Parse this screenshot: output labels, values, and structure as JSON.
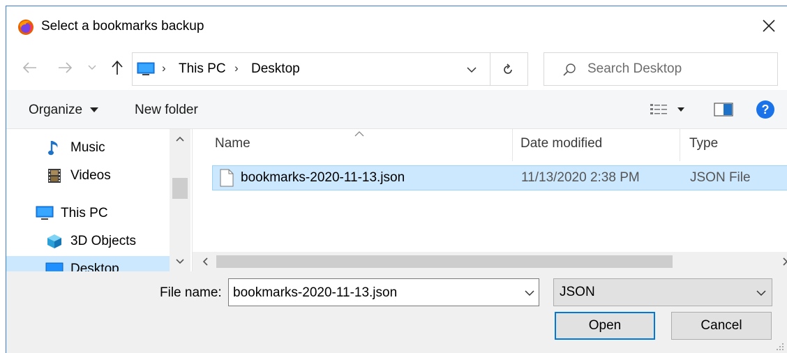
{
  "window": {
    "title": "Select a bookmarks backup"
  },
  "address": {
    "crumbs": [
      "This PC",
      "Desktop"
    ]
  },
  "search": {
    "placeholder": "Search Desktop"
  },
  "toolbar": {
    "organize_label": "Organize",
    "new_folder_label": "New folder"
  },
  "nav_pane": {
    "items": [
      {
        "label": "Music",
        "icon": "music-note-icon"
      },
      {
        "label": "Videos",
        "icon": "film-icon"
      },
      {
        "label": "This PC",
        "icon": "computer-icon"
      },
      {
        "label": "3D Objects",
        "icon": "cube-icon"
      },
      {
        "label": "Desktop",
        "icon": "desktop-icon",
        "selected": true
      }
    ]
  },
  "file_list": {
    "columns": [
      "Name",
      "Date modified",
      "Type"
    ],
    "rows": [
      {
        "name": "bookmarks-2020-11-13.json",
        "date_modified": "11/13/2020 2:38 PM",
        "type": "JSON File",
        "selected": true
      }
    ]
  },
  "bottom": {
    "file_name_label": "File name:",
    "file_name_value": "bookmarks-2020-11-13.json",
    "file_type_value": "JSON",
    "open_label": "Open",
    "cancel_label": "Cancel"
  },
  "colors": {
    "selection": "#cce8ff",
    "selection_border": "#99d1ff",
    "accent": "#0078d7",
    "help": "#1a73e8"
  }
}
